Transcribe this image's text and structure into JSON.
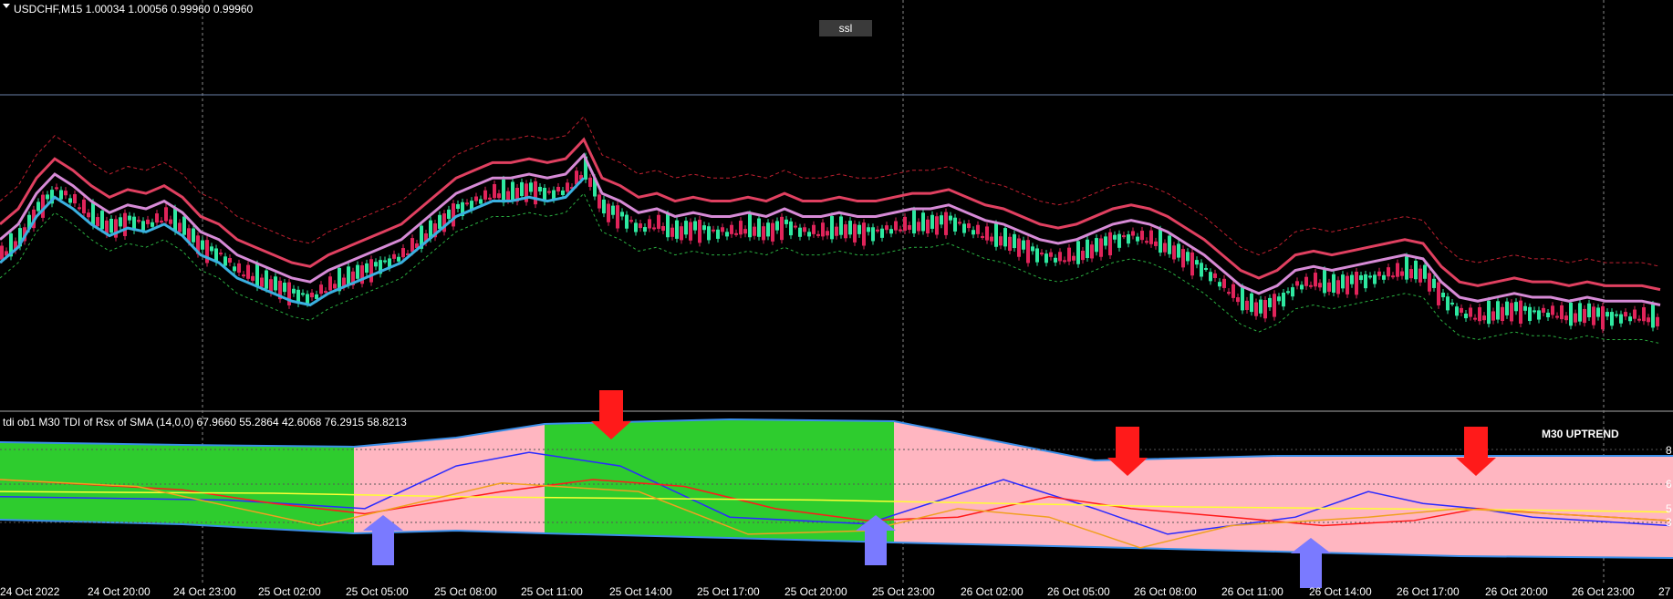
{
  "chart_data": [
    {
      "type": "candlestick",
      "title": "USDCHF,M15  1.00034 1.00056 0.99960 0.99960",
      "annotation": "ssl",
      "x_tick_labels": [
        "24 Oct 2022",
        "24 Oct 20:00",
        "24 Oct 23:00",
        "25 Oct 02:00",
        "25 Oct 05:00",
        "25 Oct 08:00",
        "25 Oct 11:00",
        "25 Oct 14:00",
        "25 Oct 17:00",
        "25 Oct 20:00",
        "25 Oct 23:00",
        "26 Oct 02:00",
        "26 Oct 05:00",
        "26 Oct 08:00",
        "26 Oct 11:00",
        "26 Oct 14:00",
        "26 Oct 17:00",
        "26 Oct 20:00",
        "26 Oct 23:00",
        "27"
      ],
      "price_path": [
        [
          0,
          62
        ],
        [
          20,
          58
        ],
        [
          40,
          50
        ],
        [
          60,
          45
        ],
        [
          80,
          48
        ],
        [
          100,
          52
        ],
        [
          120,
          55
        ],
        [
          140,
          53
        ],
        [
          160,
          54
        ],
        [
          180,
          52
        ],
        [
          200,
          55
        ],
        [
          220,
          60
        ],
        [
          240,
          62
        ],
        [
          260,
          66
        ],
        [
          280,
          68
        ],
        [
          300,
          70
        ],
        [
          320,
          72
        ],
        [
          340,
          73
        ],
        [
          360,
          70
        ],
        [
          380,
          68
        ],
        [
          400,
          66
        ],
        [
          420,
          64
        ],
        [
          440,
          62
        ],
        [
          460,
          58
        ],
        [
          480,
          54
        ],
        [
          500,
          50
        ],
        [
          520,
          48
        ],
        [
          540,
          46
        ],
        [
          560,
          46
        ],
        [
          580,
          45
        ],
        [
          600,
          46
        ],
        [
          620,
          45
        ],
        [
          640,
          40
        ],
        [
          660,
          50
        ],
        [
          680,
          52
        ],
        [
          700,
          55
        ],
        [
          720,
          54
        ],
        [
          740,
          56
        ],
        [
          760,
          55
        ],
        [
          780,
          56
        ],
        [
          800,
          56
        ],
        [
          820,
          55
        ],
        [
          840,
          56
        ],
        [
          860,
          54
        ],
        [
          880,
          56
        ],
        [
          900,
          56
        ],
        [
          920,
          55
        ],
        [
          940,
          56
        ],
        [
          960,
          56
        ],
        [
          980,
          55
        ],
        [
          1000,
          54
        ],
        [
          1020,
          54
        ],
        [
          1040,
          53
        ],
        [
          1060,
          55
        ],
        [
          1080,
          57
        ],
        [
          1100,
          58
        ],
        [
          1120,
          60
        ],
        [
          1140,
          62
        ],
        [
          1160,
          63
        ],
        [
          1180,
          62
        ],
        [
          1200,
          60
        ],
        [
          1220,
          58
        ],
        [
          1240,
          57
        ],
        [
          1260,
          58
        ],
        [
          1280,
          60
        ],
        [
          1300,
          63
        ],
        [
          1320,
          66
        ],
        [
          1340,
          70
        ],
        [
          1360,
          74
        ],
        [
          1380,
          76
        ],
        [
          1400,
          74
        ],
        [
          1420,
          70
        ],
        [
          1440,
          69
        ],
        [
          1460,
          70
        ],
        [
          1480,
          69
        ],
        [
          1500,
          68
        ],
        [
          1520,
          67
        ],
        [
          1540,
          66
        ],
        [
          1560,
          67
        ],
        [
          1580,
          73
        ],
        [
          1600,
          77
        ],
        [
          1620,
          78
        ],
        [
          1640,
          77
        ],
        [
          1660,
          76
        ],
        [
          1680,
          77
        ],
        [
          1700,
          77
        ],
        [
          1720,
          78
        ],
        [
          1740,
          77
        ],
        [
          1760,
          78
        ],
        [
          1780,
          78
        ],
        [
          1800,
          78
        ],
        [
          1820,
          79
        ]
      ],
      "price_path_units": "relative decline (0 = top of visible range, 100 = bottom)"
    },
    {
      "type": "line",
      "title": "tdi ob1 M30  TDI of Rsx of SMA (14,0,0) 67.9660 55.2864 42.6068 76.2915 58.8213",
      "badge": "M30 UPTREND",
      "y_ticks": [
        "8",
        "6",
        "5",
        "3"
      ],
      "series": [
        {
          "color": "#2a2aff",
          "values": [
            [
              0,
              52
            ],
            [
              250,
              50
            ],
            [
              400,
              45
            ],
            [
              500,
              70
            ],
            [
              580,
              78
            ],
            [
              680,
              70
            ],
            [
              800,
              40
            ],
            [
              950,
              36
            ],
            [
              1100,
              62
            ],
            [
              1200,
              45
            ],
            [
              1280,
              30
            ],
            [
              1420,
              40
            ],
            [
              1500,
              55
            ],
            [
              1560,
              48
            ],
            [
              1620,
              45
            ],
            [
              1680,
              40
            ],
            [
              1830,
              35
            ]
          ]
        },
        {
          "color": "#ff1a1a",
          "values": [
            [
              0,
              62
            ],
            [
              200,
              56
            ],
            [
              300,
              48
            ],
            [
              400,
              42
            ],
            [
              550,
              55
            ],
            [
              650,
              62
            ],
            [
              750,
              58
            ],
            [
              850,
              45
            ],
            [
              950,
              38
            ],
            [
              1050,
              40
            ],
            [
              1150,
              52
            ],
            [
              1240,
              45
            ],
            [
              1350,
              40
            ],
            [
              1450,
              35
            ],
            [
              1550,
              38
            ],
            [
              1620,
              45
            ],
            [
              1700,
              42
            ],
            [
              1830,
              38
            ]
          ]
        },
        {
          "color": "#ffff33",
          "values": [
            [
              0,
              55
            ],
            [
              300,
              54
            ],
            [
              500,
              52
            ],
            [
              700,
              51
            ],
            [
              900,
              50
            ],
            [
              1100,
              48
            ],
            [
              1300,
              46
            ],
            [
              1500,
              45
            ],
            [
              1700,
              44
            ],
            [
              1830,
              43
            ]
          ]
        },
        {
          "color": "#f0a020",
          "values": [
            [
              0,
              62
            ],
            [
              150,
              58
            ],
            [
              350,
              35
            ],
            [
              550,
              60
            ],
            [
              700,
              55
            ],
            [
              820,
              30
            ],
            [
              950,
              32
            ],
            [
              1050,
              45
            ],
            [
              1150,
              40
            ],
            [
              1250,
              22
            ],
            [
              1350,
              35
            ],
            [
              1500,
              40
            ],
            [
              1600,
              45
            ],
            [
              1700,
              42
            ],
            [
              1830,
              38
            ]
          ]
        }
      ],
      "bands": {
        "upper_color": "#3a8ee8",
        "lower_color": "#3a8ee8"
      },
      "zones": [
        {
          "from": 0,
          "to": 388,
          "color": "#2ecc2e"
        },
        {
          "from": 388,
          "to": 597,
          "color": "#ffb6c1"
        },
        {
          "from": 597,
          "to": 980,
          "color": "#2ecc2e"
        },
        {
          "from": 980,
          "to": 1834,
          "color": "#ffb6c1"
        }
      ],
      "arrows_down": [
        670,
        1236,
        1618
      ],
      "arrows_up": [
        420,
        960,
        1437
      ]
    }
  ]
}
